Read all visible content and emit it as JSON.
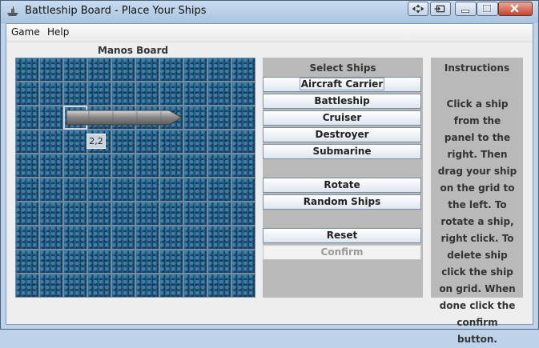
{
  "window": {
    "title": "Battleship Board - Place Your Ships"
  },
  "menu": {
    "items": [
      "Game",
      "Help"
    ]
  },
  "board": {
    "label": "Manos Board",
    "rows": 10,
    "cols": 10,
    "selected_cell": "2,2",
    "coordinate_tooltip": "2,2"
  },
  "select_panel": {
    "title": "Select Ships",
    "ship_buttons": [
      "Aircraft Carrier",
      "Battleship",
      "Cruiser",
      "Destroyer",
      "Submarine"
    ],
    "rotate_label": "Rotate",
    "random_label": "Random Ships",
    "reset_label": "Reset",
    "confirm_label": "Confirm"
  },
  "instructions": {
    "title": "Instructions",
    "text": "Click a ship from the panel to the right. Then drag your ship on the grid to the left. To rotate a ship, right click. To delete ship click the ship on grid. When done click the confirm button."
  },
  "icons": {
    "app": "battleship-icon",
    "minimize": "minimize-icon",
    "maximize": "maximize-icon",
    "close": "close-icon"
  }
}
